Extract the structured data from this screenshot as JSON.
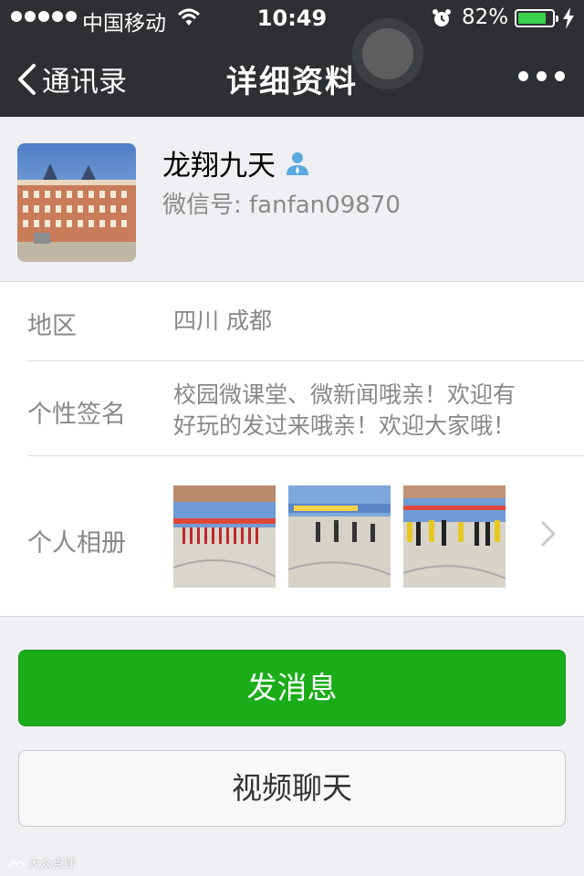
{
  "status_bar": {
    "carrier": "中国移动",
    "time": "10:49",
    "battery_percent": "82%",
    "battery_level": 0.82,
    "signal_bars": 5
  },
  "nav": {
    "back_label": "通讯录",
    "title": "详细资料"
  },
  "profile": {
    "name": "龙翔九天",
    "wechat_id": "微信号: fanfan09870",
    "icons": [
      "person-badge-icon"
    ]
  },
  "info": {
    "region_label": "地区",
    "region_value": "四川 成都",
    "signature_label": "个性签名",
    "signature_line1": "校园微课堂、微新闻哦亲！欢迎有",
    "signature_line2": "好玩的发过来哦亲！欢迎大家哦！",
    "album_label": "个人相册"
  },
  "buttons": {
    "send_message": "发消息",
    "video_chat": "视频聊天"
  },
  "watermark": "大众点评",
  "colors": {
    "nav_bg": "#2e2f33",
    "accent_green": "#1aad19",
    "page_bg": "#efeff4"
  }
}
